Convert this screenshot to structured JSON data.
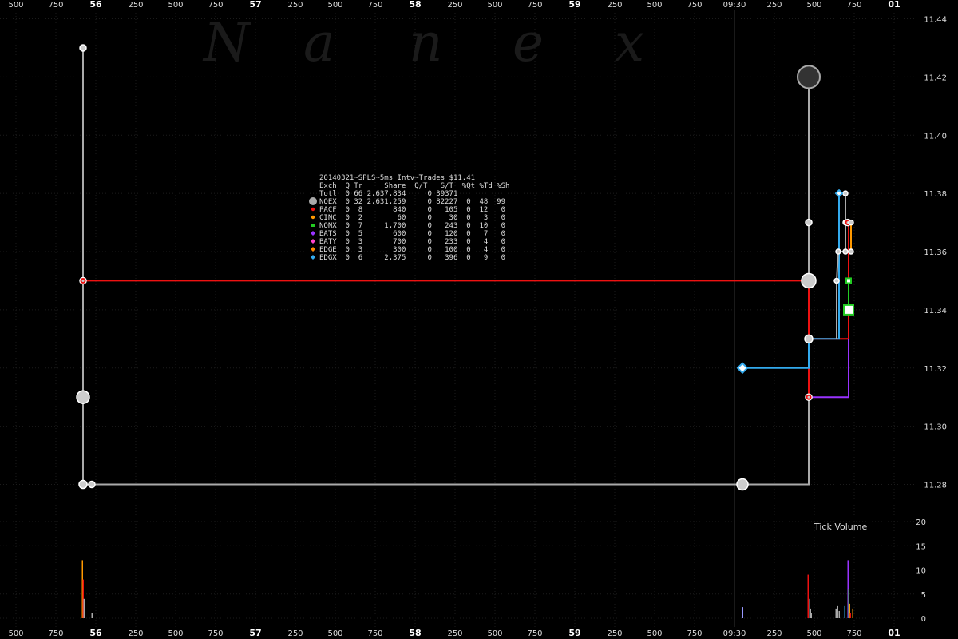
{
  "watermark": [
    "N",
    "a",
    "n",
    "e",
    "x"
  ],
  "x_ticks": [
    {
      "t": -245,
      "label": "500",
      "major": false
    },
    {
      "t": -195,
      "label": "750",
      "major": false
    },
    {
      "t": -145,
      "label": "56",
      "major": true
    },
    {
      "t": -95,
      "label": "250",
      "major": false
    },
    {
      "t": -45,
      "label": "500",
      "major": false
    },
    {
      "t": 5,
      "label": "750",
      "major": false
    },
    {
      "t": 55,
      "label": "57",
      "major": true
    },
    {
      "t": 105,
      "label": "250",
      "major": false
    },
    {
      "t": 155,
      "label": "500",
      "major": false
    },
    {
      "t": 205,
      "label": "750",
      "major": false
    },
    {
      "t": 255,
      "label": "58",
      "major": true
    },
    {
      "t": 305,
      "label": "250",
      "major": false
    },
    {
      "t": 355,
      "label": "500",
      "major": false
    },
    {
      "t": 405,
      "label": "750",
      "major": false
    },
    {
      "t": 455,
      "label": "59",
      "major": true
    },
    {
      "t": 505,
      "label": "250",
      "major": false
    },
    {
      "t": 555,
      "label": "500",
      "major": false
    },
    {
      "t": 605,
      "label": "750",
      "major": false
    },
    {
      "t": 655,
      "label": "09:30",
      "major": false,
      "time": true
    },
    {
      "t": 705,
      "label": "250",
      "major": false
    },
    {
      "t": 755,
      "label": "500",
      "major": false
    },
    {
      "t": 805,
      "label": "750",
      "major": false
    },
    {
      "t": 855,
      "label": "01",
      "major": true
    }
  ],
  "chart_data": {
    "type": "line",
    "title": "20140321~SPLS~5ms Intv~Trades $11.41",
    "x_unit": "ms relative to 09:30:00.000",
    "xlim": [
      -265,
      935
    ],
    "price_ylim": [
      11.27,
      11.445
    ],
    "price_ticks": [
      "11.44",
      "11.42",
      "11.40",
      "11.38",
      "11.36",
      "11.34",
      "11.32",
      "11.30",
      "11.28"
    ],
    "volume_title": "Tick Volume",
    "volume_ylim": [
      0,
      21
    ],
    "volume_ticks": [
      "20",
      "15",
      "10",
      "5",
      "0"
    ],
    "grid": true,
    "legend": {
      "header": "Exch  Q Tr     Share  Q/T   S/T  %Qt %Td %Sh",
      "rows": [
        {
          "text": "Totl  0 66 2,637,834     0 39371",
          "color": "",
          "marker": "none"
        },
        {
          "text": "NQEX  0 32 2,631,259     0 82227  0  48  99",
          "color": "#aaaaaa",
          "marker": "big-circle"
        },
        {
          "text": "PACF  0  8       840     0   105  0  12   0",
          "color": "#ee1111",
          "marker": "circle"
        },
        {
          "text": "CINC  0  2        60     0    30  0   3   0",
          "color": "#ff9900",
          "marker": "circle"
        },
        {
          "text": "NQNX  0  7     1,700     0   243  0  10   0",
          "color": "#22cc22",
          "marker": "square"
        },
        {
          "text": "BATS  0  5       600     0   120  0   7   0",
          "color": "#9933ff",
          "marker": "diamond"
        },
        {
          "text": "BATY  0  3       700     0   233  0   4   0",
          "color": "#ff44cc",
          "marker": "diamond"
        },
        {
          "text": "EDGE  0  3       300     0   100  0   4   0",
          "color": "#ff8800",
          "marker": "diamond"
        },
        {
          "text": "EDGX  0  6     2,375     0   396  0   9   0",
          "color": "#33aaee",
          "marker": "diamond"
        }
      ]
    },
    "series": [
      {
        "exch": "NQEX",
        "color": "#aaaaaa",
        "points": [
          [
            -161,
            11.43
          ],
          [
            -161,
            11.28
          ],
          [
            -150,
            11.28
          ],
          [
            665,
            11.28
          ],
          [
            664,
            11.28
          ],
          [
            748,
            11.28
          ],
          [
            748,
            11.35
          ],
          [
            748,
            11.37
          ],
          [
            748,
            11.42
          ]
        ]
      },
      {
        "exch": "PACF",
        "color": "#ee1111",
        "points": [
          [
            -161,
            11.35
          ],
          [
            748,
            11.35
          ],
          [
            748,
            11.31
          ],
          [
            748,
            11.33
          ],
          [
            798,
            11.33
          ],
          [
            798,
            11.37
          ],
          [
            798,
            11.35
          ]
        ]
      },
      {
        "exch": "EDGX",
        "color": "#33aaee",
        "points": [
          [
            665,
            11.32
          ],
          [
            748,
            11.32
          ],
          [
            748,
            11.33
          ],
          [
            786,
            11.33
          ],
          [
            786,
            11.38
          ],
          [
            793,
            11.38
          ]
        ]
      },
      {
        "exch": "BATS",
        "color": "#9933ff",
        "points": [
          [
            748,
            11.31
          ],
          [
            798,
            11.31
          ],
          [
            798,
            11.33
          ]
        ]
      },
      {
        "exch": "NQNX",
        "color": "#22cc22",
        "points": [
          [
            798,
            11.35
          ],
          [
            798,
            11.34
          ]
        ]
      },
      {
        "exch": "CINC",
        "color": "#ff9900",
        "points": [
          [
            801,
            11.37
          ],
          [
            801,
            11.36
          ]
        ]
      },
      {
        "exch": "NQEX-b",
        "color": "#aaaaaa",
        "points": [
          [
            783,
            11.33
          ],
          [
            783,
            11.35
          ],
          [
            785,
            11.36
          ],
          [
            794,
            11.36
          ],
          [
            794,
            11.37
          ],
          [
            794,
            11.38
          ]
        ]
      }
    ],
    "markers": [
      {
        "exch": "NQEX",
        "x": -161,
        "y": 11.43,
        "r": 4
      },
      {
        "exch": "NQEX",
        "x": -161,
        "y": 11.31,
        "r": 8
      },
      {
        "exch": "NQEX",
        "x": -161,
        "y": 11.28,
        "r": 5
      },
      {
        "exch": "NQEX",
        "x": -150,
        "y": 11.28,
        "r": 4
      },
      {
        "exch": "NQEX",
        "x": 665,
        "y": 11.28,
        "r": 7
      },
      {
        "exch": "NQEX",
        "x": 748,
        "y": 11.42,
        "r": 14
      },
      {
        "exch": "NQEX",
        "x": 748,
        "y": 11.35,
        "r": 9
      },
      {
        "exch": "NQEX",
        "x": 748,
        "y": 11.37,
        "r": 4
      },
      {
        "exch": "NQEX",
        "x": 748,
        "y": 11.33,
        "r": 5
      },
      {
        "exch": "NQEX",
        "x": 783,
        "y": 11.35,
        "r": 3
      },
      {
        "exch": "NQEX",
        "x": 785,
        "y": 11.36,
        "r": 3
      },
      {
        "exch": "NQEX",
        "x": 794,
        "y": 11.38,
        "r": 3
      },
      {
        "exch": "NQEX",
        "x": 794,
        "y": 11.37,
        "r": 3
      },
      {
        "exch": "NQEX",
        "x": 794,
        "y": 11.36,
        "r": 3
      },
      {
        "exch": "PACF",
        "x": -161,
        "y": 11.35,
        "r": 4
      },
      {
        "exch": "PACF",
        "x": 748,
        "y": 11.31,
        "r": 4
      },
      {
        "exch": "PACF",
        "x": 797,
        "y": 11.37,
        "r": 4
      },
      {
        "exch": "EDGX",
        "x": 665,
        "y": 11.32,
        "r": 6,
        "shape": "diamond"
      },
      {
        "exch": "EDGX",
        "x": 786,
        "y": 11.38,
        "r": 4,
        "shape": "diamond"
      },
      {
        "exch": "NQNX",
        "x": 798,
        "y": 11.35,
        "r": 3,
        "shape": "square"
      },
      {
        "exch": "NQNX",
        "x": 798,
        "y": 11.34,
        "r": 6,
        "shape": "square"
      },
      {
        "exch": "CINC",
        "x": 801,
        "y": 11.37,
        "r": 3
      },
      {
        "exch": "CINC",
        "x": 801,
        "y": 11.36,
        "r": 3
      }
    ],
    "volume_bars": [
      {
        "x": -162,
        "v": 12,
        "color": "#ff9900"
      },
      {
        "x": -161,
        "v": 8,
        "color": "#ee1111"
      },
      {
        "x": -160,
        "v": 4,
        "color": "#aaaaaa"
      },
      {
        "x": -150,
        "v": 1,
        "color": "#aaaaaa"
      },
      {
        "x": 665,
        "v": 2.3,
        "color": "#9999ff"
      },
      {
        "x": 747,
        "v": 9,
        "color": "#ee1111"
      },
      {
        "x": 749,
        "v": 4,
        "color": "#aaaaaa"
      },
      {
        "x": 750,
        "v": 2,
        "color": "#aaaaaa"
      },
      {
        "x": 751,
        "v": 1,
        "color": "#aaaaaa"
      },
      {
        "x": 782,
        "v": 2,
        "color": "#aaaaaa"
      },
      {
        "x": 784,
        "v": 2.5,
        "color": "#aaaaaa"
      },
      {
        "x": 786,
        "v": 1.5,
        "color": "#aaaaaa"
      },
      {
        "x": 793,
        "v": 2.5,
        "color": "#33aaee"
      },
      {
        "x": 797,
        "v": 12,
        "color": "#9933ff"
      },
      {
        "x": 798,
        "v": 6,
        "color": "#22cc22"
      },
      {
        "x": 799,
        "v": 3,
        "color": "#ff9900"
      },
      {
        "x": 800,
        "v": 1,
        "color": "#ee1111"
      },
      {
        "x": 803,
        "v": 2,
        "color": "#ff9900"
      }
    ]
  }
}
